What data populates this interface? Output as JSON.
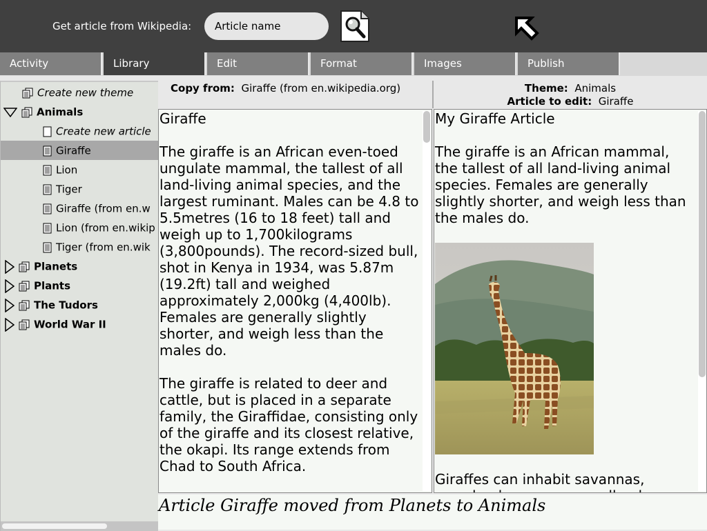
{
  "toolbar": {
    "fetch_label": "Get article from Wikipedia:",
    "search_value": "Article name"
  },
  "tabs": [
    {
      "label": "Activity"
    },
    {
      "label": "Library",
      "active": true
    },
    {
      "label": "Edit"
    },
    {
      "label": "Format"
    },
    {
      "label": "Images"
    },
    {
      "label": "Publish"
    }
  ],
  "tree": {
    "create_theme": "Create new theme",
    "themes": [
      {
        "label": "Animals",
        "expanded": true
      },
      {
        "label": "Planets"
      },
      {
        "label": "Plants"
      },
      {
        "label": "The Tudors"
      },
      {
        "label": "World War II"
      }
    ],
    "create_article": "Create new article",
    "articles": [
      "Giraffe",
      "Lion",
      "Tiger",
      "Giraffe (from en.w",
      "Lion (from en.wikip",
      "Tiger (from en.wik"
    ],
    "selected_article": "Giraffe"
  },
  "copy_from": {
    "label": "Copy from:",
    "value": "Giraffe (from en.wikipedia.org)"
  },
  "edit_info": {
    "theme_label": "Theme:",
    "theme_value": "Animals",
    "article_label": "Article to edit:",
    "article_value": "Giraffe"
  },
  "source_article": {
    "title": "Giraffe",
    "paragraphs": [
      "The giraffe is an African even-toed ungulate mammal, the tallest of all land-living animal species, and the largest ruminant. Males can be 4.8 to 5.5metres (16 to 18 feet) tall and weigh up to 1,700kilograms (3,800pounds). The record-sized bull, shot in Kenya in 1934, was 5.87m (19.2ft) tall and weighed approximately 2,000kg (4,400lb). Females are generally slightly shorter, and weigh less than the males do.",
      "The giraffe is related to deer and cattle, but is placed in a separate family, the Giraffidae, consisting only of the giraffe and its closest relative, the okapi. Its range extends from Chad to South Africa."
    ]
  },
  "edited_article": {
    "title": "My Giraffe Article",
    "paragraphs": [
      "The giraffe is an African mammal, the tallest of all land-living animal species. Females are generally slightly shorter, and weigh less than the males do.",
      "Giraffes can inhabit savannas, grasslands, or open woodlands."
    ]
  },
  "status_message": "Article Giraffe moved from Planets to Animals",
  "colors": {
    "toolbar_bg": "#404040",
    "tab_bg": "#808080",
    "tab_active_bg": "#404040",
    "tree_bg": "#e0e3de",
    "tree_selected": "#a8a8a8",
    "pane_bg": "#f5f8f4"
  }
}
